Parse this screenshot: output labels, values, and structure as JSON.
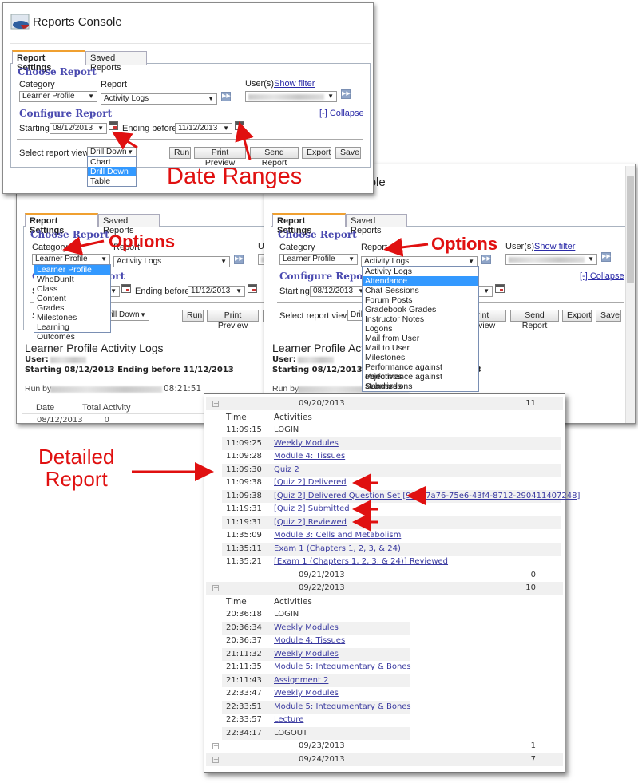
{
  "app_title": "Reports Console",
  "settings": {
    "tabs": [
      "Report Settings",
      "Saved Reports"
    ],
    "choose_heading": "Choose Report",
    "category_label": "Category",
    "report_label": "Report",
    "users_label": "User(s)",
    "show_filter": "Show filter",
    "category_value": "Learner Profile",
    "report_value": "Activity Logs",
    "configure_heading": "Configure Report",
    "collapse": "[-] Collapse",
    "starting_label": "Starting",
    "start_date": "08/12/2013",
    "ending_label": "Ending before",
    "end_date": "11/12/2013",
    "view_label": "Select report view",
    "view_value": "Drill Down",
    "buttons": [
      "Run",
      "Print Preview",
      "Send Report",
      "Export",
      "Save"
    ],
    "view_options": [
      "Chart",
      "Drill Down",
      "Table"
    ],
    "view_selected": "Drill Down",
    "category_options": [
      "Learner Profile",
      "WhoDunIt",
      "Class",
      "Content",
      "Grades",
      "Milestones",
      "Learning Outcomes"
    ],
    "category_selected": "Learner Profile",
    "report_options": [
      "Activity Logs",
      "Attendance",
      "Chat Sessions",
      "Forum Posts",
      "Gradebook Grades",
      "Instructor Notes",
      "Logons",
      "Mail from User",
      "Mail to User",
      "Milestones",
      "Performance against objectives",
      "Performance against standards",
      "Submissions"
    ],
    "report_selected": "Attendance"
  },
  "report_output": {
    "title": "Learner Profile Activity Logs",
    "user_label": "User:",
    "range_text": "Starting 08/12/2013 Ending before 11/12/2013",
    "run_by_label": "Run by",
    "run_time": "08:21:51",
    "columns": [
      "Date",
      "Total Activity"
    ],
    "rows": [
      [
        "08/12/2013",
        "0"
      ]
    ]
  },
  "detail": {
    "time_header": "Time",
    "activities_header": "Activities",
    "groups": [
      {
        "date": "09/20/2013",
        "count": "11",
        "expanded": true,
        "rows": [
          [
            "11:09:15",
            "LOGIN",
            false
          ],
          [
            "11:09:25",
            "Weekly Modules",
            true
          ],
          [
            "11:09:28",
            "Module 4: Tissues",
            true
          ],
          [
            "11:09:30",
            "Quiz 2",
            true
          ],
          [
            "11:09:38",
            "[Quiz 2] Delivered",
            true
          ],
          [
            "11:09:38",
            "[Quiz 2] Delivered Question Set [9a6a7a76-75e6-43f4-8712-290411407248]",
            true
          ],
          [
            "11:19:31",
            "[Quiz 2] Submitted",
            true
          ],
          [
            "11:19:31",
            "[Quiz 2] Reviewed",
            true
          ],
          [
            "11:35:09",
            "Module 3: Cells and Metabolism",
            true
          ],
          [
            "11:35:11",
            "Exam 1 (Chapters 1, 2, 3, & 24)",
            true
          ],
          [
            "11:35:21",
            "[Exam 1 (Chapters 1, 2, 3, & 24)] Reviewed",
            true
          ]
        ]
      },
      {
        "date": "09/21/2013",
        "count": "0",
        "expanded": false,
        "rows": []
      },
      {
        "date": "09/22/2013",
        "count": "10",
        "expanded": true,
        "rows": [
          [
            "20:36:18",
            "LOGIN",
            false
          ],
          [
            "20:36:34",
            "Weekly Modules",
            true
          ],
          [
            "20:36:37",
            "Module 4: Tissues",
            true
          ],
          [
            "21:11:32",
            "Weekly Modules",
            true
          ],
          [
            "21:11:35",
            "Module 5: Integumentary & Bones",
            true
          ],
          [
            "21:11:43",
            "Assignment 2",
            true
          ],
          [
            "22:33:47",
            "Weekly Modules",
            true
          ],
          [
            "22:33:51",
            "Module 5: Integumentary & Bones",
            true
          ],
          [
            "22:33:57",
            "Lecture",
            true
          ],
          [
            "22:34:17",
            "LOGOUT",
            false
          ]
        ]
      },
      {
        "date": "09/23/2013",
        "count": "1",
        "expanded": false,
        "rows": []
      },
      {
        "date": "09/24/2013",
        "count": "7",
        "expanded": false,
        "rows": []
      }
    ]
  },
  "annotations": {
    "date_ranges": "Date Ranges",
    "options": "Options",
    "detailed_report": [
      "Detailed",
      "Report"
    ]
  },
  "colors": {
    "heading": "#4a4ab0",
    "link": "#2a2aa8",
    "highlight": "#3399ff",
    "annotation": "#e01010",
    "active_tab": "#f0a030"
  }
}
